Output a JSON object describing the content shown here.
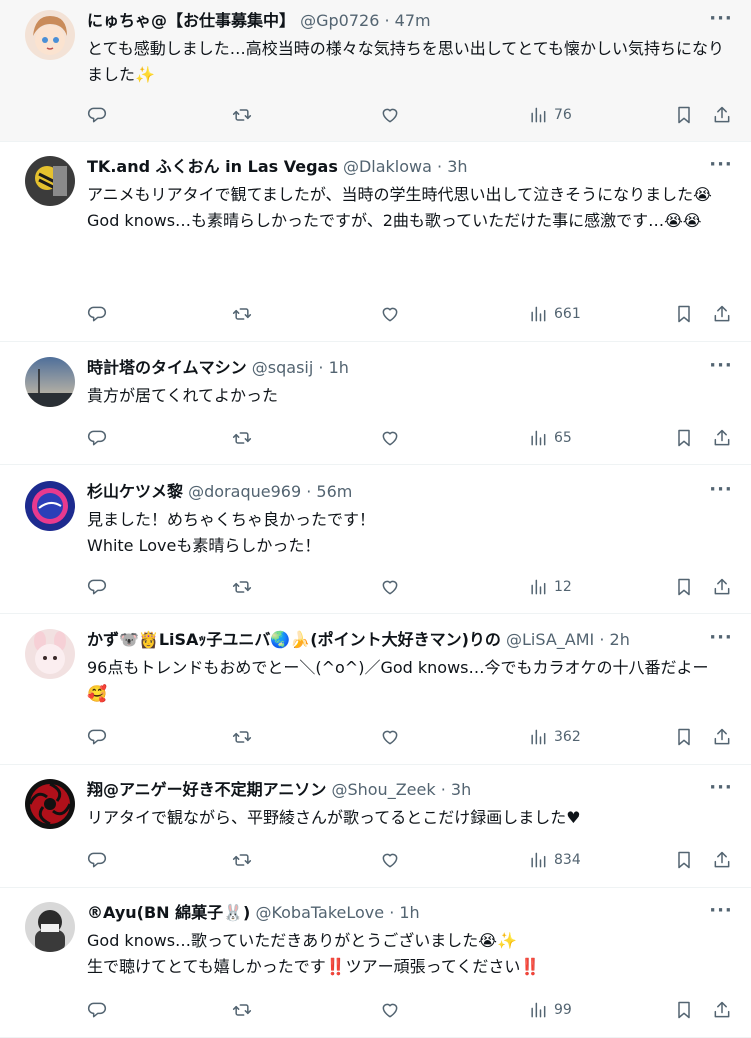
{
  "tweets": [
    {
      "name": "にゅちゃ@【お仕事募集中】",
      "handle": "@Gp0726",
      "sep": "·",
      "time": "47m",
      "body": "とても感動しました…高校当時の様々な気持ちを思い出してとても懐かしい気持ちになりました✨",
      "views": "76",
      "avatar_color": "#d9a58a"
    },
    {
      "name": "TK.and ふくおん in Las Vegas",
      "handle": "@Dlaklowa",
      "sep": "·",
      "time": "3h",
      "body": "アニメもリアタイで観てましたが、当時の学生時代思い出して泣きそうになりました😭\nGod knows…も素晴らしかったですが、2曲も歌っていただけた事に感激です…😭😭",
      "views": "661",
      "avatar_color": "#2b2b2b"
    },
    {
      "name": "時計塔のタイムマシン",
      "handle": "@sqasij",
      "sep": "·",
      "time": "1h",
      "body": "貴方が居てくれてよかった",
      "views": "65",
      "avatar_color": "#6f8fb0"
    },
    {
      "name": "杉山ケツメ黎",
      "handle": "@doraque969",
      "sep": "·",
      "time": "56m",
      "body": "見ました！めちゃくちゃ良かったです！\nWhite Loveも素晴らしかった！",
      "views": "12",
      "avatar_color": "#1d2b8f"
    },
    {
      "name": "かず🐨👸LiSAｯ子ユニバ🌏🍌(ポイント大好きマン)りの",
      "handle": "@LiSA_AMI",
      "sep": "·",
      "time": "2h",
      "body": "96点もトレンドもおめでとー＼(^o^)／God knows…今でもカラオケの十八番だよー🥰",
      "views": "362",
      "avatar_color": "#e8c9c9"
    },
    {
      "name": "翔@アニゲー好き不定期アニソン",
      "handle": "@Shou_Zeek",
      "sep": "·",
      "time": "3h",
      "body": "リアタイで観ながら、平野綾さんが歌ってるとこだけ録画しました♥",
      "views": "834",
      "avatar_color": "#b0101a"
    },
    {
      "name": "®Ayu(BN 綿菓子🐰)",
      "handle": "@KobaTakeLove",
      "sep": "·",
      "time": "1h",
      "body": "God knows…歌っていただきありがとうございました😭✨\n生で聴けてとても嬉しかったです‼️ツアー頑張ってください‼️",
      "views": "99",
      "avatar_color": "#3a3a3a"
    }
  ],
  "more_label": "···"
}
